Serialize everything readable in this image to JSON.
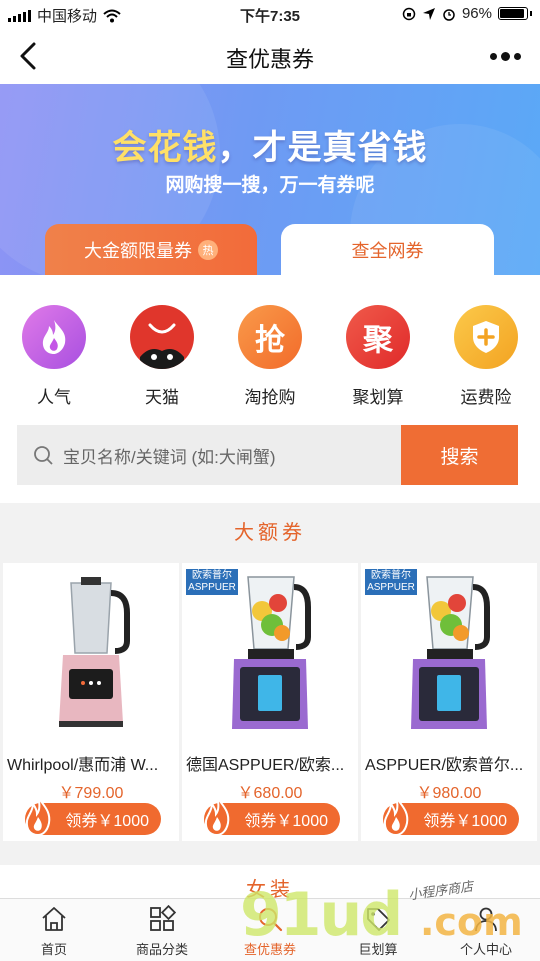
{
  "status_bar": {
    "carrier": "中国移动",
    "time": "下午7:35",
    "battery": "96%"
  },
  "nav": {
    "title": "查优惠券"
  },
  "banner": {
    "headline_highlight": "会花钱",
    "headline_rest": "，才是真省钱",
    "subtitle": "网购搜一搜，万一有券呢",
    "tab_left": "大金额限量券",
    "tab_left_badge": "热",
    "tab_right": "查全网券"
  },
  "categories": [
    {
      "label": "人气",
      "icon": "flame-icon",
      "color": "#c456e6"
    },
    {
      "label": "天猫",
      "icon": "tmall-icon",
      "color": "#e0362c"
    },
    {
      "label": "淘抢购",
      "icon": "qiang-icon",
      "color": "#f5752a",
      "glyph": "抢"
    },
    {
      "label": "聚划算",
      "icon": "ju-icon",
      "color": "#e83a3a",
      "glyph": "聚"
    },
    {
      "label": "运费险",
      "icon": "shield-plus-icon",
      "color": "#f5b52b"
    }
  ],
  "search": {
    "placeholder": "宝贝名称/关键词 (如:大闸蟹)",
    "button": "搜索"
  },
  "section_title": "大额券",
  "products": [
    {
      "title": "Whirlpool/惠而浦 W...",
      "price": "￥799.00",
      "coupon": "领券￥1000",
      "brand": ""
    },
    {
      "title": "德国ASPPUER/欧索...",
      "price": "￥680.00",
      "coupon": "领券￥1000",
      "brand": "欧索普尔 ASPPUER"
    },
    {
      "title": "ASPPUER/欧索普尔...",
      "price": "￥980.00",
      "coupon": "领券￥1000",
      "brand": "欧索普尔 ASPPUER"
    }
  ],
  "next_section_title": "女装",
  "tabbar": [
    {
      "label": "首页",
      "icon": "home-icon"
    },
    {
      "label": "商品分类",
      "icon": "grid-icon"
    },
    {
      "label": "查优惠券",
      "icon": "search-icon",
      "active": true
    },
    {
      "label": "巨划算",
      "icon": "tag-icon"
    },
    {
      "label": "个人中心",
      "icon": "user-icon"
    }
  ],
  "watermark": {
    "big": "91ud",
    "com": ".com",
    "small": "小程序商店"
  },
  "colors": {
    "accent": "#ef6d34",
    "banner_start": "#8f93f5",
    "banner_end": "#5aa9f7"
  }
}
